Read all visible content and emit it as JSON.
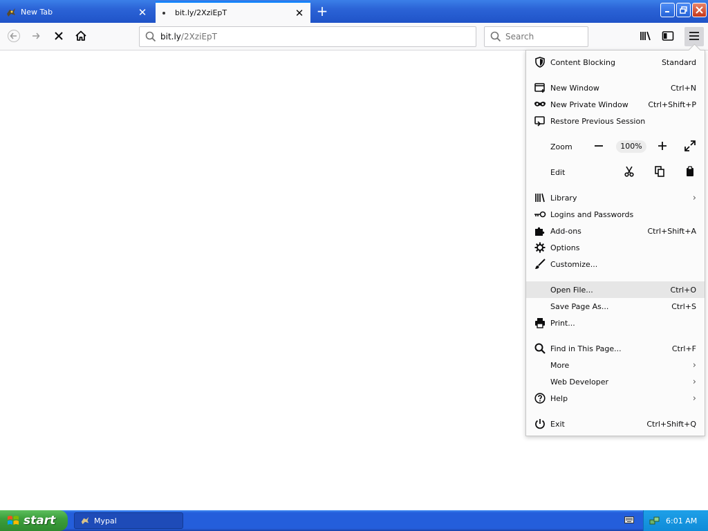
{
  "tabs": [
    {
      "title": "New Tab",
      "active": false
    },
    {
      "title": "bit.ly/2XziEpT",
      "active": true
    }
  ],
  "urlbar": {
    "host": "bit.ly",
    "path": "/2XziEpT"
  },
  "search": {
    "placeholder": "Search"
  },
  "menu": {
    "content_blocking": {
      "label": "Content Blocking",
      "value": "Standard"
    },
    "new_window": {
      "label": "New Window",
      "shortcut": "Ctrl+N"
    },
    "new_private_window": {
      "label": "New Private Window",
      "shortcut": "Ctrl+Shift+P"
    },
    "restore_session": {
      "label": "Restore Previous Session"
    },
    "zoom": {
      "label": "Zoom",
      "value": "100%"
    },
    "edit": {
      "label": "Edit"
    },
    "library": {
      "label": "Library"
    },
    "logins": {
      "label": "Logins and Passwords"
    },
    "addons": {
      "label": "Add-ons",
      "shortcut": "Ctrl+Shift+A"
    },
    "options": {
      "label": "Options"
    },
    "customize": {
      "label": "Customize..."
    },
    "open_file": {
      "label": "Open File...",
      "shortcut": "Ctrl+O"
    },
    "save_page": {
      "label": "Save Page As...",
      "shortcut": "Ctrl+S"
    },
    "print": {
      "label": "Print..."
    },
    "find": {
      "label": "Find in This Page...",
      "shortcut": "Ctrl+F"
    },
    "more": {
      "label": "More"
    },
    "web_developer": {
      "label": "Web Developer"
    },
    "help": {
      "label": "Help"
    },
    "exit": {
      "label": "Exit",
      "shortcut": "Ctrl+Shift+Q"
    }
  },
  "taskbar": {
    "start_label": "start",
    "items": [
      {
        "label": "Mypal"
      }
    ],
    "clock": "6:01 AM"
  },
  "colors": {
    "accent": "#0a84ff",
    "taskbar": "#245edb",
    "start": "#3c9f3c"
  }
}
